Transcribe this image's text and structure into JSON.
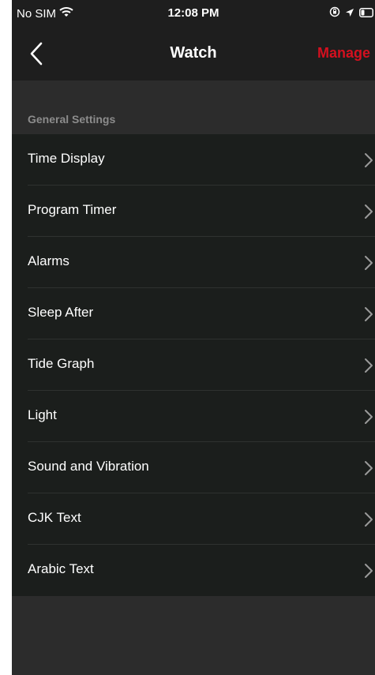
{
  "status_bar": {
    "carrier": "No SIM",
    "time": "12:08 PM"
  },
  "nav": {
    "title": "Watch",
    "manage_label": "Manage",
    "accent_color": "#d4101f"
  },
  "section": {
    "header": "General Settings"
  },
  "settings_items": [
    {
      "label": "Time Display"
    },
    {
      "label": "Program Timer"
    },
    {
      "label": "Alarms"
    },
    {
      "label": "Sleep After"
    },
    {
      "label": "Tide Graph"
    },
    {
      "label": "Light"
    },
    {
      "label": "Sound and Vibration"
    },
    {
      "label": "CJK Text"
    },
    {
      "label": "Arabic Text"
    }
  ],
  "icons": {
    "status": [
      "wifi-icon",
      "rotation-lock-icon",
      "location-arrow-icon",
      "battery-icon"
    ],
    "nav": [
      "back-chevron-icon"
    ],
    "row": "chevron-right-icon"
  }
}
